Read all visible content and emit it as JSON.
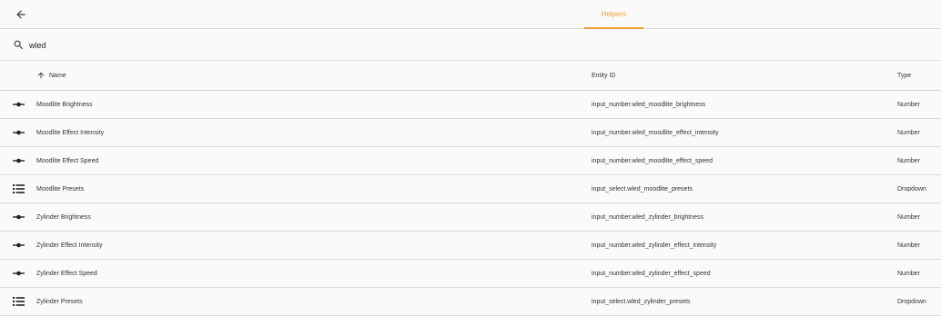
{
  "header": {
    "back_icon": "arrow-left-icon",
    "tab_label": "Helpers",
    "accent_color": "#f0a033"
  },
  "search": {
    "icon": "search-icon",
    "value": "wled"
  },
  "table": {
    "columns": {
      "name": "Name",
      "entity_id": "Entity ID",
      "type": "Type"
    },
    "sort_icon": "arrow-up-icon",
    "rows": [
      {
        "icon": "slider-icon",
        "name": "Moodlite Brightness",
        "entity_id": "input_number.wled_moodlite_brightness",
        "type": "Number"
      },
      {
        "icon": "slider-icon",
        "name": "Moodlite Effect Intensity",
        "entity_id": "input_number.wled_moodlite_effect_intensity",
        "type": "Number"
      },
      {
        "icon": "slider-icon",
        "name": "Moodlite Effect Speed",
        "entity_id": "input_number.wled_moodlite_effect_speed",
        "type": "Number"
      },
      {
        "icon": "list-icon",
        "name": "Moodlite Presets",
        "entity_id": "input_select.wled_moodlite_presets",
        "type": "Dropdown"
      },
      {
        "icon": "slider-icon",
        "name": "Zylinder Brightness",
        "entity_id": "input_number.wled_zylinder_brightness",
        "type": "Number"
      },
      {
        "icon": "slider-icon",
        "name": "Zylinder Effect Intensity",
        "entity_id": "input_number.wled_zylinder_effect_intensity",
        "type": "Number"
      },
      {
        "icon": "slider-icon",
        "name": "Zylinder Effect Speed",
        "entity_id": "input_number.wled_zylinder_effect_speed",
        "type": "Number"
      },
      {
        "icon": "list-icon",
        "name": "Zylinder Presets",
        "entity_id": "input_select.wled_zylinder_presets",
        "type": "Dropdown"
      }
    ]
  }
}
